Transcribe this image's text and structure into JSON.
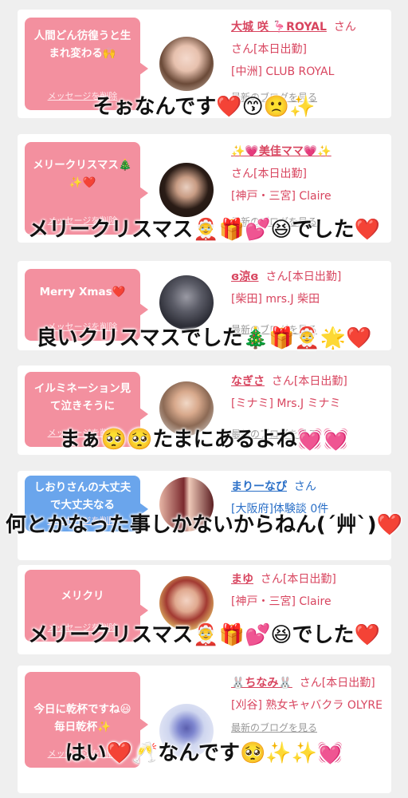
{
  "common": {
    "delete_label": "メッセージを削除",
    "blog_label": "最新のブログを見る",
    "san": "さん"
  },
  "cards": [
    {
      "message": "人間どん彷徨うと生まれ変わる🙌",
      "name": "大城 咲 🦩ROYAL",
      "line2": "さん[本日出勤]",
      "line3": "[中洲] CLUB ROYAL",
      "caption": "そぉなんです❤️😙🙁✨"
    },
    {
      "message": "メリークリスマス🎄✨❤️",
      "name": "✨💗美佳ママ💗✨",
      "line2": "さん[本日出勤]",
      "line3": "[神戸・三宮] Claire",
      "caption": "メリークリスマス🤶🎁💕😆でした❤️"
    },
    {
      "message": "Merry Xmas❤️",
      "name": "ɞ涼ɞ",
      "line2": "さん[本日出勤]",
      "line3": "[柴田] mrs.J 柴田",
      "caption": "良いクリスマスでした🎄🎁🤶🌟❤️"
    },
    {
      "message": "イルミネーション見て泣きそうに",
      "name": "なぎさ",
      "line2": "さん[本日出勤]",
      "line3": "[ミナミ] Mrs.J ミナミ",
      "caption": "まぁ🥺🥺たまにあるよね💓💓"
    },
    {
      "message": "しおりさんの大丈夫で大丈夫なる",
      "name": "まりーなぴ",
      "line2": "さん",
      "line3": "[大阪府]体験談 0件",
      "caption": "何とかなった事しかないからねん(´艸`)❤️"
    },
    {
      "message": "メリクリ",
      "name": "まゆ",
      "line2": "さん[本日出勤]",
      "line3": "[神戸・三宮] Claire",
      "caption": "メリークリスマス🤶🎁💕😆でした❤️"
    },
    {
      "message": "今日に乾杯ですね😃毎日乾杯✨",
      "name": "🐰ちなみ🐰",
      "line2": "さん[本日出勤]",
      "line3": "[刈谷] 熟女キャバクラ OLYRE",
      "caption": "はい❤️🥂なんです🥺✨✨💓"
    }
  ],
  "colors": {
    "bubble_pink": "#f3909f",
    "bubble_blue": "#6aa5ec",
    "name_pink": "#d8455f",
    "name_blue": "#2a6fc7"
  }
}
